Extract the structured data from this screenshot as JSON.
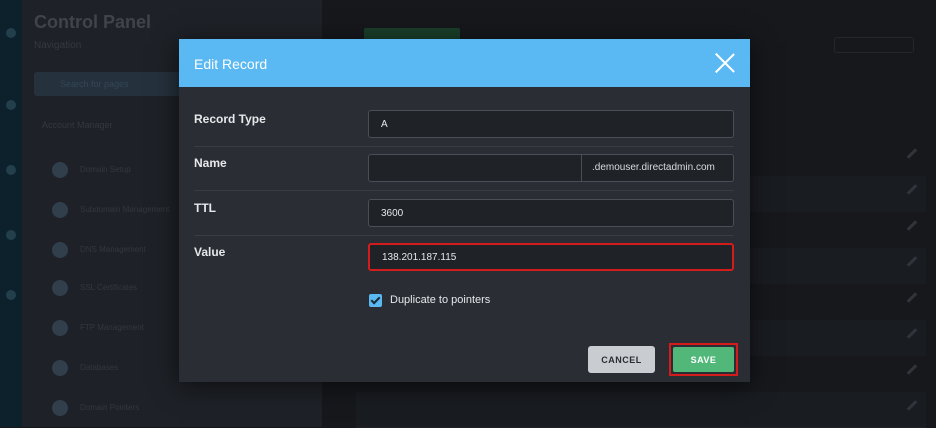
{
  "background": {
    "sidebar": {
      "title": "Control Panel",
      "subtitle": "Navigation",
      "search_placeholder": "Search for pages",
      "section": "Account Manager",
      "items": [
        {
          "label": "Domain Setup"
        },
        {
          "label": "Subdomain Management"
        },
        {
          "label": "DNS Management"
        },
        {
          "label": "SSL Certificates"
        },
        {
          "label": "FTP Management"
        },
        {
          "label": "Databases"
        },
        {
          "label": "Domain Pointers"
        }
      ]
    }
  },
  "modal": {
    "title": "Edit Record",
    "fields": {
      "record_type": {
        "label": "Record Type",
        "value": "A"
      },
      "name": {
        "label": "Name",
        "value": "",
        "suffix": ".demouser.directadmin.com"
      },
      "ttl": {
        "label": "TTL",
        "value": "3600"
      },
      "value": {
        "label": "Value",
        "value": "138.201.187.115"
      }
    },
    "duplicate_to_pointers": {
      "label": "Duplicate to pointers",
      "checked": true
    },
    "buttons": {
      "cancel": "CANCEL",
      "save": "SAVE"
    }
  },
  "colors": {
    "header": "#5ab8f2",
    "save": "#52b87a",
    "highlight": "#d41c1c",
    "modal_bg": "#2a2d33"
  }
}
